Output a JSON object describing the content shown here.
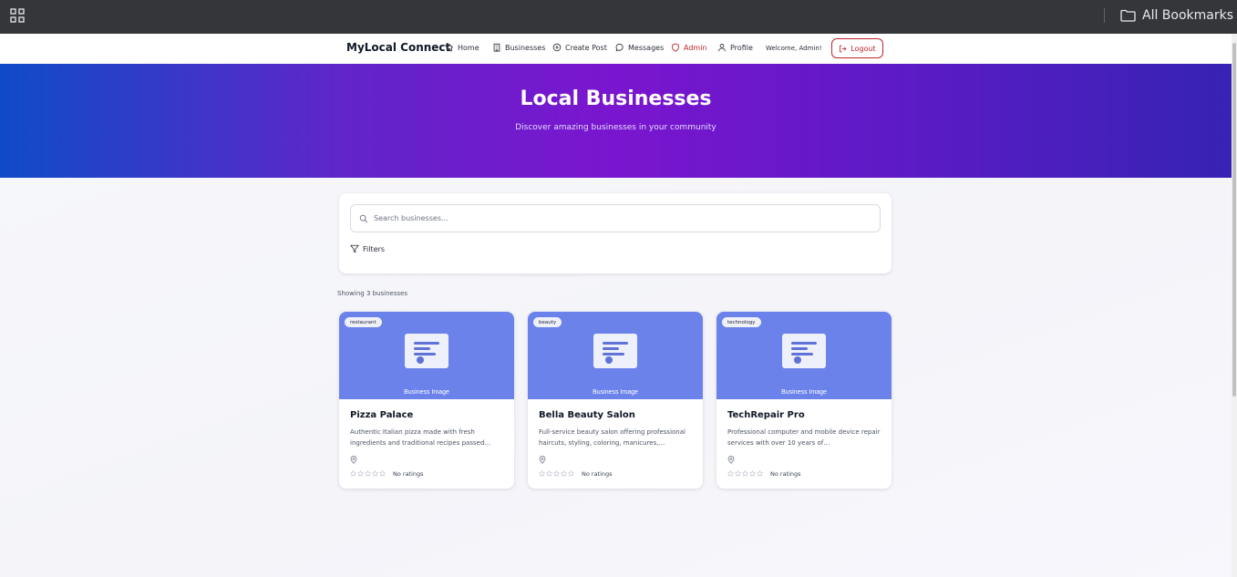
{
  "browser": {
    "bookmarks_label": "All Bookmarks"
  },
  "nav": {
    "brand": "MyLocal Connect",
    "items": [
      {
        "label": "Home",
        "icon": "home-icon"
      },
      {
        "label": "Businesses",
        "icon": "building-icon"
      },
      {
        "label": "Create Post",
        "icon": "plus-circle-icon"
      },
      {
        "label": "Messages",
        "icon": "message-icon"
      },
      {
        "label": "Admin",
        "icon": "shield-icon"
      },
      {
        "label": "Profile",
        "icon": "user-icon"
      }
    ],
    "welcome": "Welcome, Admin!",
    "logout": "Logout"
  },
  "hero": {
    "title": "Local Businesses",
    "subtitle": "Discover amazing businesses in your community"
  },
  "search": {
    "placeholder": "Search businesses...",
    "filters_label": "Filters"
  },
  "results": {
    "count_text": "Showing 3 businesses"
  },
  "businesses": [
    {
      "category": "restaurant",
      "image_label": "Business Image",
      "name": "Pizza Palace",
      "description": "Authentic Italian pizza made with fresh ingredients and traditional recipes passed…",
      "rating_text": "No ratings",
      "stars": 0
    },
    {
      "category": "beauty",
      "image_label": "Business Image",
      "name": "Bella Beauty Salon",
      "description": "Full-service beauty salon offering professional haircuts, styling, coloring, manicures,…",
      "rating_text": "No ratings",
      "stars": 0
    },
    {
      "category": "technology",
      "image_label": "Business Image",
      "name": "TechRepair Pro",
      "description": "Professional computer and mobile device repair services with over 10 years of…",
      "rating_text": "No ratings",
      "stars": 0
    }
  ],
  "colors": {
    "accent_red": "#c0262d",
    "hero_start": "#0f4bc8",
    "hero_mid": "#7a15cf",
    "hero_end": "#3623b3",
    "card_image_bg": "#6a82ea"
  }
}
